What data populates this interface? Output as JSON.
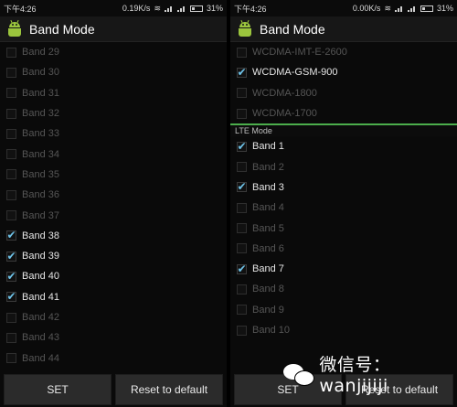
{
  "status_left": {
    "time": "下午4:26",
    "net_speed": "0.19K/s",
    "battery": "31%"
  },
  "status_right": {
    "time": "下午4:26",
    "net_speed": "0.00K/s",
    "battery": "31%"
  },
  "app": {
    "title": "Band Mode"
  },
  "left_bands": [
    {
      "label": "Band 29",
      "checked": false
    },
    {
      "label": "Band 30",
      "checked": false
    },
    {
      "label": "Band 31",
      "checked": false
    },
    {
      "label": "Band 32",
      "checked": false
    },
    {
      "label": "Band 33",
      "checked": false
    },
    {
      "label": "Band 34",
      "checked": false
    },
    {
      "label": "Band 35",
      "checked": false
    },
    {
      "label": "Band 36",
      "checked": false
    },
    {
      "label": "Band 37",
      "checked": false
    },
    {
      "label": "Band 38",
      "checked": true
    },
    {
      "label": "Band 39",
      "checked": true
    },
    {
      "label": "Band 40",
      "checked": true
    },
    {
      "label": "Band 41",
      "checked": true
    },
    {
      "label": "Band 42",
      "checked": false
    },
    {
      "label": "Band 43",
      "checked": false
    },
    {
      "label": "Band 44",
      "checked": false
    }
  ],
  "right_wcdma": [
    {
      "label": "WCDMA-IMT-E-2600",
      "checked": false
    },
    {
      "label": "WCDMA-GSM-900",
      "checked": true
    },
    {
      "label": "WCDMA-1800",
      "checked": false
    },
    {
      "label": "WCDMA-1700",
      "checked": false
    }
  ],
  "lte_section_label": "LTE Mode",
  "right_lte": [
    {
      "label": "Band 1",
      "checked": true
    },
    {
      "label": "Band 2",
      "checked": false
    },
    {
      "label": "Band 3",
      "checked": true
    },
    {
      "label": "Band 4",
      "checked": false
    },
    {
      "label": "Band 5",
      "checked": false
    },
    {
      "label": "Band 6",
      "checked": false
    },
    {
      "label": "Band 7",
      "checked": true
    },
    {
      "label": "Band 8",
      "checked": false
    },
    {
      "label": "Band 9",
      "checked": false
    },
    {
      "label": "Band 10",
      "checked": false
    }
  ],
  "buttons": {
    "set": "SET",
    "reset": "Reset to default"
  },
  "watermark": "微信号：wanjijiji",
  "colors": {
    "check": "#6fc3e8",
    "section_line": "#4cae4c",
    "button_bg": "#2b2b2b",
    "android": "#9bc53d"
  }
}
